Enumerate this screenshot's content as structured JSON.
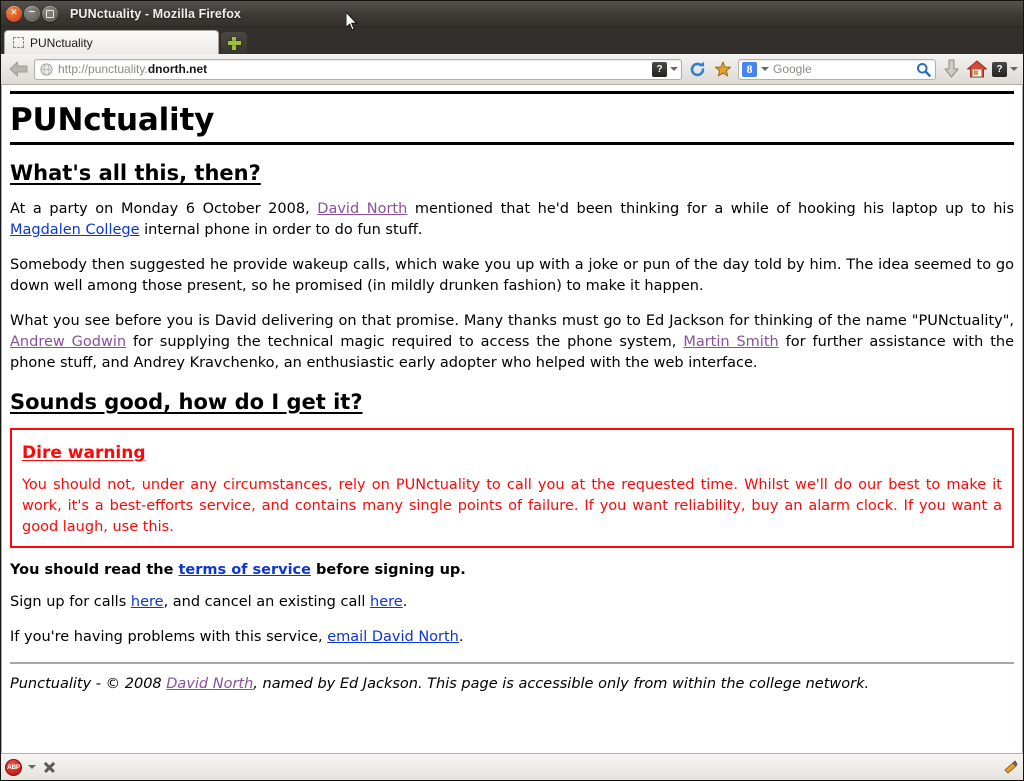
{
  "window": {
    "title": "PUNctuality - Mozilla Firefox",
    "controls": {
      "close": "×",
      "minimize": "−",
      "maximize": ""
    }
  },
  "tabs": {
    "items": [
      {
        "label": "PUNctuality",
        "favicon": "blank-favicon-icon",
        "active": true
      }
    ],
    "new_tab_label": "+"
  },
  "toolbar": {
    "back_label": "Back",
    "url_prefix": "http://punctuality.",
    "url_domain": "dnorth.net",
    "url_full": "http://punctuality.dnorth.net",
    "placeholder_glyph": "?",
    "reload_label": "Reload",
    "bookmark_label": "Bookmark this page",
    "search_engine": "Google",
    "search_placeholder": "Google",
    "search_value": "",
    "search_button_label": "Search",
    "downloads_label": "Downloads",
    "home_label": "Home",
    "overflow_glyph": "?"
  },
  "page": {
    "title": "PUNctuality",
    "sections": [
      {
        "heading": "What's all this, then?"
      },
      {
        "heading": "Sounds good, how do I get it?"
      }
    ],
    "paragraph1": {
      "t1": "At a party on Monday 6 October 2008, ",
      "link1": "David North",
      "t2": " mentioned that he'd been thinking for a while of hooking his laptop up to his ",
      "link2": "Magdalen College",
      "t3": " internal phone in order to do fun stuff."
    },
    "paragraph2": "Somebody then suggested he provide wakeup calls, which wake you up with a joke or pun of the day told by him. The idea seemed to go down well among those present, so he promised (in mildly drunken fashion) to make it happen.",
    "paragraph3": {
      "t1": "What you see before you is David delivering on that promise. Many thanks must go to Ed Jackson for thinking of the name \"PUNctuality\", ",
      "link1": "Andrew Godwin",
      "t2": " for supplying the technical magic required to access the phone system, ",
      "link2": "Martin Smith",
      "t3": " for further assistance with the phone stuff, and Andrey Kravchenko, an enthusiastic early adopter who helped with the web interface."
    },
    "warning": {
      "heading": "Dire warning",
      "text": "You should not, under any circumstances, rely on PUNctuality to call you at the requested time. Whilst we'll do our best to make it work, it's a best-efforts service, and contains many single points of failure. If you want reliability, buy an alarm clock. If you want a good laugh, use this.",
      "border_color": "#fc0808",
      "text_color": "#fc0808"
    },
    "tos_line": {
      "t1": "You should read the ",
      "link": "terms of service",
      "t2": " before signing up."
    },
    "signup_line": {
      "t1": "Sign up for calls ",
      "link1": "here",
      "t2": ", and cancel an existing call ",
      "link2": "here",
      "t3": "."
    },
    "problems_line": {
      "t1": "If you're having problems with this service, ",
      "link": "email David North",
      "t2": "."
    },
    "footer": {
      "t1": "Punctuality - © 2008 ",
      "link": "David North",
      "t2": ", named by Ed Jackson. This page is accessible only from within the college network."
    },
    "link_colors": {
      "unvisited": "#0b35d6",
      "visited": "#8a4f9e"
    }
  },
  "statusbar": {
    "adblock_label": "ABP",
    "stop_label": "Stop",
    "grip_label": "Resize"
  }
}
